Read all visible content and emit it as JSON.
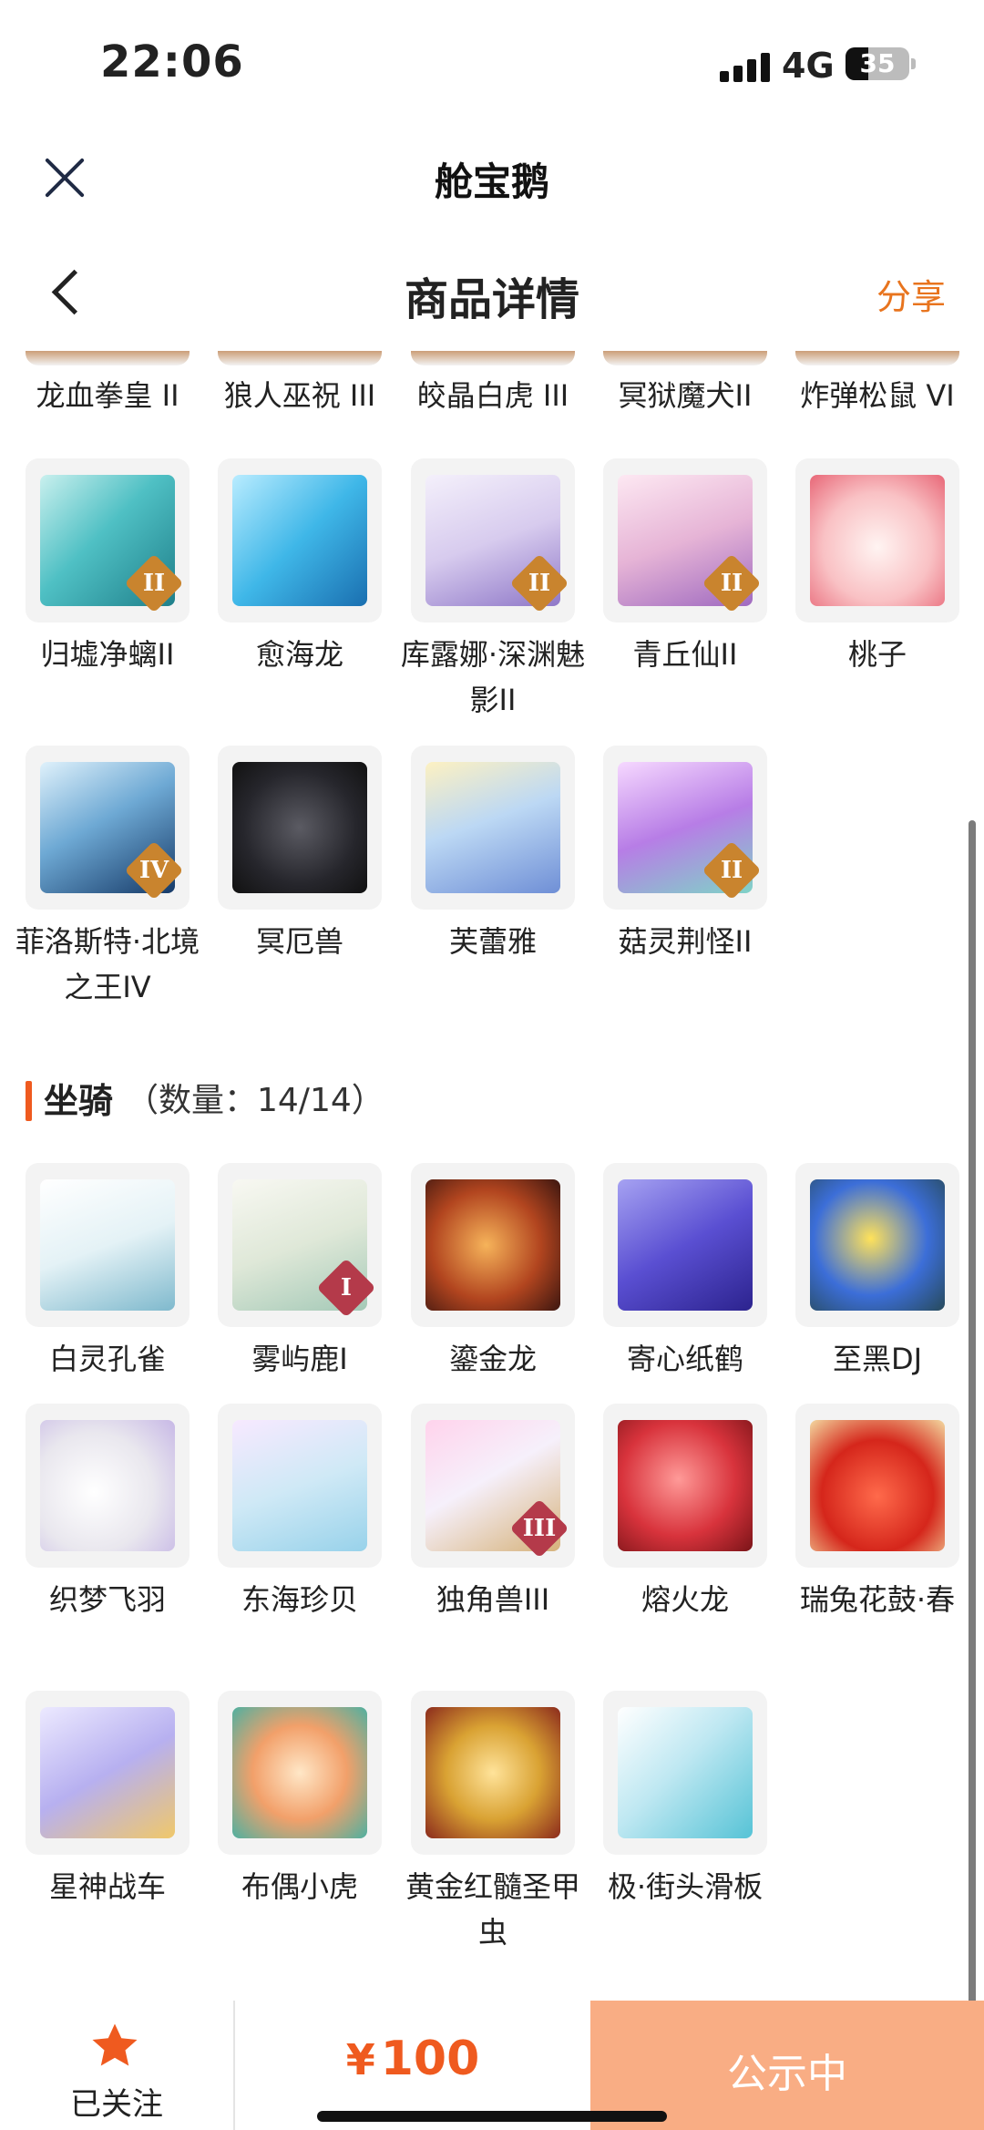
{
  "status_bar": {
    "time": "22:06",
    "network": "4G",
    "battery": "35"
  },
  "app_header": {
    "title": "舱宝鹅"
  },
  "page_header": {
    "title": "商品详情",
    "share_label": "分享"
  },
  "pets_partial_row": [
    "龙血拳皇 II",
    "狼人巫祝 III",
    "皎晶白虎 III",
    "冥狱魔犬II",
    "炸弹松鼠 VI"
  ],
  "pets": [
    {
      "name": "归墟净螭II",
      "badge": "II",
      "badge_color": "#c9842e",
      "art": "teal-dragon"
    },
    {
      "name": "愈海龙",
      "badge": "",
      "badge_color": "",
      "art": "sea-dragon"
    },
    {
      "name": "库露娜·深渊魅影II",
      "badge": "II",
      "badge_color": "#c9842e",
      "art": "white-hair-girl"
    },
    {
      "name": "青丘仙II",
      "badge": "II",
      "badge_color": "#c9842e",
      "art": "fox-fairy"
    },
    {
      "name": "桃子",
      "badge": "",
      "badge_color": "",
      "art": "pink-bunny"
    },
    {
      "name": "菲洛斯特·北境之王IV",
      "badge": "IV",
      "badge_color": "#c9842e",
      "art": "ice-knight"
    },
    {
      "name": "冥厄兽",
      "badge": "",
      "badge_color": "",
      "art": "black-beast"
    },
    {
      "name": "芙蕾雅",
      "badge": "",
      "badge_color": "",
      "art": "valkyrie"
    },
    {
      "name": "菇灵荆怪II",
      "badge": "II",
      "badge_color": "#c9842e",
      "art": "mushroom-sprite"
    }
  ],
  "mounts_section": {
    "label": "坐骑",
    "count": "（数量：14/14）"
  },
  "mounts": [
    {
      "name": "白灵孔雀",
      "badge": "",
      "badge_color": "",
      "art": "white-peacock"
    },
    {
      "name": "雾屿鹿I",
      "badge": "I",
      "badge_color": "#b43a4a",
      "art": "white-deer"
    },
    {
      "name": "鎏金龙",
      "badge": "",
      "badge_color": "",
      "art": "gold-dragon"
    },
    {
      "name": "寄心纸鹤",
      "badge": "",
      "badge_color": "",
      "art": "paper-crane"
    },
    {
      "name": "至黑DJ",
      "badge": "",
      "badge_color": "",
      "art": "dj-helmet"
    },
    {
      "name": "织梦飞羽",
      "badge": "",
      "badge_color": "",
      "art": "feather"
    },
    {
      "name": "东海珍贝",
      "badge": "",
      "badge_color": "",
      "art": "shell"
    },
    {
      "name": "独角兽III",
      "badge": "III",
      "badge_color": "#b43a4a",
      "art": "unicorn"
    },
    {
      "name": "熔火龙",
      "badge": "",
      "badge_color": "",
      "art": "fire-dragon"
    },
    {
      "name": "瑞兔花鼓·春",
      "badge": "",
      "badge_color": "",
      "art": "rabbit-drum"
    },
    {
      "name": "星神战车",
      "badge": "",
      "badge_color": "",
      "art": "star-steed"
    },
    {
      "name": "布偶小虎",
      "badge": "",
      "badge_color": "",
      "art": "cloth-tiger"
    },
    {
      "name": "黄金红髓圣甲虫",
      "badge": "",
      "badge_color": "",
      "art": "golden-scarab"
    },
    {
      "name": "极·街头滑板",
      "badge": "",
      "badge_color": "",
      "art": "skateboard"
    }
  ],
  "bottom_bar": {
    "follow_label": "已关注",
    "price_symbol": "¥",
    "price": "100",
    "status_label": "公示中"
  },
  "colors": {
    "accent": "#ef5a1f",
    "share": "#e8741e",
    "status_button": "#f9ad84"
  }
}
